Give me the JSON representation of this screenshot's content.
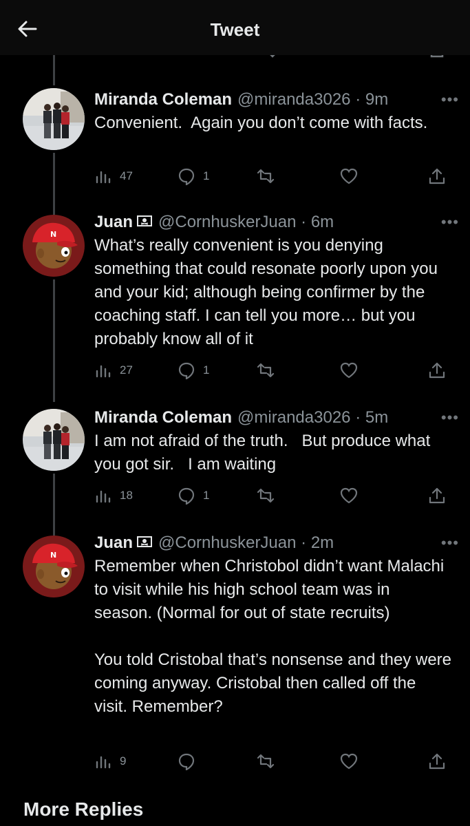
{
  "topbar": {
    "title": "Tweet"
  },
  "tweets": [
    {
      "name": "Miranda Coleman",
      "handle": "@miranda3026",
      "time": "9m",
      "text": "Convenient.  Again you don’t come with facts.",
      "views": "47",
      "replies": "1",
      "avatar": "family-photo-avatar",
      "flag": false
    },
    {
      "name": "Juan",
      "handle": "@CornhuskerJuan",
      "time": "6m",
      "text": "What’s really convenient is you denying something that could resonate poorly upon you and your kid; although being confirmer by the coaching staff. I can tell you more… but you probably know all of it",
      "views": "27",
      "replies": "1",
      "avatar": "cartoon-cap-avatar",
      "flag": true
    },
    {
      "name": "Miranda Coleman",
      "handle": "@miranda3026",
      "time": "5m",
      "text": "I am not afraid of the truth.   But produce what you got sir.   I am waiting",
      "views": "18",
      "replies": "1",
      "avatar": "family-photo-avatar",
      "flag": false
    },
    {
      "name": "Juan",
      "handle": "@CornhuskerJuan",
      "time": "2m",
      "text": "Remember when Christobol didn’t want Malachi to visit while his high school team was in season. (Normal for out of state recruits)\n\nYou told Cristobal that’s nonsense and they were coming anyway. Cristobal then called off the visit. Remember?",
      "views": "9",
      "replies": "",
      "avatar": "cartoon-cap-avatar",
      "flag": true
    }
  ],
  "separator": "·",
  "more_replies": "More Replies",
  "colors": {
    "background": "#000000",
    "text": "#e7e9ea",
    "secondary": "#8b9399",
    "thread_line": "#3e4144"
  }
}
